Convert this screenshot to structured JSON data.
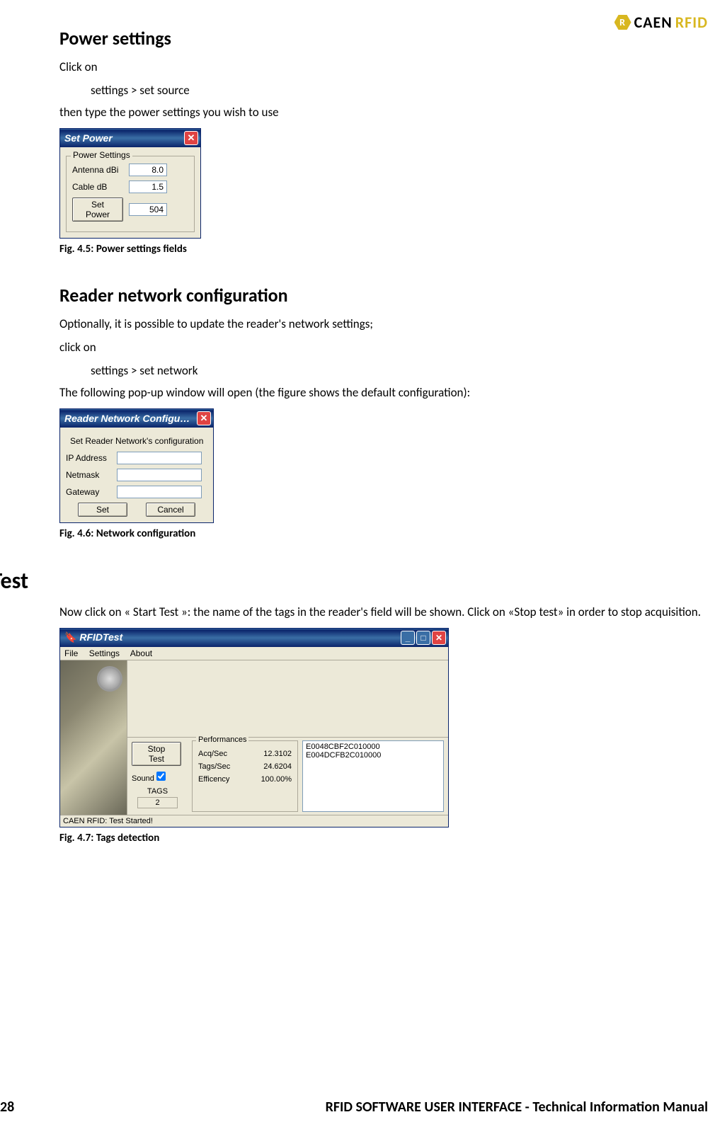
{
  "brand": {
    "caen": "CAEN",
    "rfid": "RFID",
    "hex": "R"
  },
  "section1": {
    "title": "Power settings",
    "p1": "Click on",
    "path": "settings > set source",
    "p2": "then type the power settings you wish to use"
  },
  "fig45": {
    "winTitle": "Set Power",
    "group": "Power Settings",
    "rows": [
      {
        "label": "Antenna dBi",
        "value": "8.0"
      },
      {
        "label": "Cable dB",
        "value": "1.5"
      }
    ],
    "button": "Set Power",
    "buttonValue": "504",
    "caption": "Fig. 4.5: Power settings fields"
  },
  "section2": {
    "title": "Reader network configuration",
    "p1": "Optionally, it is possible to update  the reader's network settings;",
    "p2": "click on",
    "path": "settings > set network",
    "p3": "The following pop-up window will open (the figure shows the default configuration):"
  },
  "fig46": {
    "winTitle": "Reader Network Configu…",
    "subtitle": "Set Reader Network's configuration",
    "rows": [
      {
        "label": "IP Address",
        "value": ""
      },
      {
        "label": "Netmask",
        "value": ""
      },
      {
        "label": "Gateway",
        "value": ""
      }
    ],
    "btnSet": "Set",
    "btnCancel": "Cancel",
    "caption": "Fig. 4.6: Network configuration"
  },
  "section3": {
    "title": "Start Test",
    "p1": "Now click on « Start Test »: the name of the tags in the reader's field will be shown. Click on «Stop test» in order to stop acquisition."
  },
  "fig47": {
    "winTitle": "RFIDTest",
    "menu": [
      "File",
      "Settings",
      "About"
    ],
    "btnStop": "Stop Test",
    "soundLabel": "Sound",
    "soundChecked": true,
    "tagsLabel": "TAGS",
    "tagsCount": "2",
    "perfTitle": "Performances",
    "perf": [
      {
        "label": "Acq/Sec",
        "value": "12.3102"
      },
      {
        "label": "Tags/Sec",
        "value": "24.6204"
      },
      {
        "label": "Efficency",
        "value": "100.00%"
      }
    ],
    "tags": [
      "E0048CBF2C010000",
      "E004DCFB2C010000"
    ],
    "status": "CAEN RFID: Test Started!",
    "caption": "Fig. 4.7: Tags detection"
  },
  "footer": {
    "page": "28",
    "title": "RFID SOFTWARE USER INTERFACE - Technical Information Manual"
  }
}
